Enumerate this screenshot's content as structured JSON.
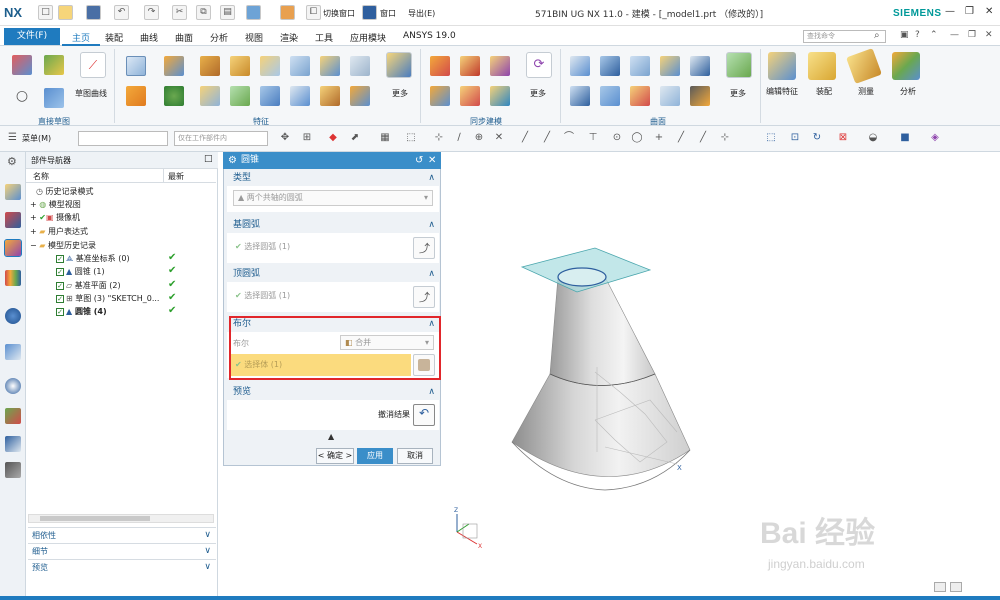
{
  "app": {
    "logo": "NX",
    "title": "571BIN UG NX 11.0 - 建模 - [_model1.prt （修改的）]",
    "brand": "SIEMENS",
    "quick_access": {
      "switch_window": "切换窗口",
      "window": "窗口",
      "export": "导出(E)"
    },
    "accent_color": "#1f7bbf"
  },
  "menu": {
    "file_tab": "文件(F)",
    "tabs": [
      "主页",
      "装配",
      "曲线",
      "曲面",
      "分析",
      "视图",
      "渲染",
      "工具",
      "应用模块",
      "ANSYS 19.0"
    ],
    "active_tab": "主页",
    "command_finder_placeholder": "查找命令"
  },
  "ribbon": {
    "groups": [
      "直接草图",
      "特征",
      "同步建模",
      "曲面"
    ],
    "sketch_curve": "草图曲线",
    "more": "更多",
    "edit_feature": "编辑特征",
    "assembly": "装配",
    "measure": "测量",
    "analysis": "分析"
  },
  "toolbar": {
    "menu_label": "菜单(M)",
    "selection_filter": "",
    "scope": "仅在工作部件内"
  },
  "navigator": {
    "title": "部件导航器",
    "columns": {
      "name": "名称",
      "latest": "最新"
    },
    "items": [
      {
        "label": "历史记录模式",
        "latest": false
      },
      {
        "label": "模型视图",
        "latest": false
      },
      {
        "label": "摄像机",
        "latest": false
      },
      {
        "label": "用户表达式",
        "latest": false
      },
      {
        "label": "模型历史记录",
        "latest": false
      },
      {
        "label": "基准坐标系 (0)",
        "latest": true
      },
      {
        "label": "圆锥 (1)",
        "latest": true
      },
      {
        "label": "基准平面 (2)",
        "latest": true
      },
      {
        "label": "草图 (3) \"SKETCH_0...",
        "latest": true
      },
      {
        "label": "圆锥 (4)",
        "latest": true
      }
    ],
    "panels": [
      "相依性",
      "细节",
      "预览"
    ]
  },
  "dialog": {
    "title": "圆锥",
    "type_section": "类型",
    "type_value": "两个共轴的圆弧",
    "base_arc_section": "基圆弧",
    "select_arc": "选择圆弧 (1)",
    "top_arc_section": "顶圆弧",
    "select_arc_top": "选择圆弧 (1)",
    "boolean_section": "布尔",
    "boolean_label": "布尔",
    "boolean_value": "合并",
    "select_body": "选择体 (1)",
    "preview_section": "预览",
    "undo_result": "撤消结果",
    "ok": "< 确定 >",
    "apply": "应用",
    "cancel": "取消"
  },
  "watermark": {
    "line1": "Bai 经验",
    "line2": "jingyan.baidu.com"
  }
}
